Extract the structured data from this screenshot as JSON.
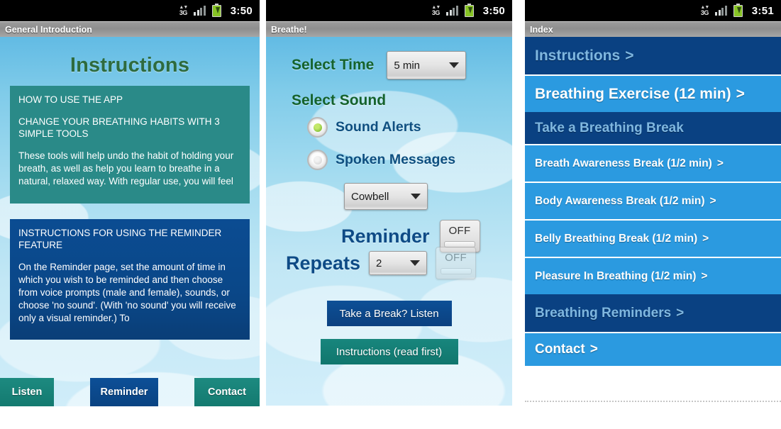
{
  "panel1": {
    "status": {
      "network": "3G",
      "time": "3:50",
      "signal_icon": "signal-bars-icon",
      "battery_icon": "battery-charging-icon",
      "network_icon": "3g-data-icon"
    },
    "title": "General Introduction",
    "heading": "Instructions",
    "box_teal": {
      "heading": "HOW TO USE THE APP",
      "subheading": " CHANGE YOUR BREATHING HABITS WITH 3 SIMPLE TOOLS",
      "body": " These tools will help undo the habit of holding your breath, as well as help you learn to breathe in a natural, relaxed way. With regular use, you will feel"
    },
    "box_navy": {
      "heading": "INSTRUCTIONS FOR USING THE REMINDER FEATURE",
      "body": " On the Reminder page, set the amount of time in which you wish to be reminded and then choose from voice prompts (male and female), sounds, or choose 'no sound'. (With 'no sound' you will receive only a visual reminder.) To"
    },
    "buttons": [
      {
        "label": "Listen",
        "style": "teal"
      },
      {
        "label": "Reminder",
        "style": "navy"
      },
      {
        "label": "Contact",
        "style": "teal"
      }
    ]
  },
  "panel2": {
    "status": {
      "network": "3G",
      "time": "3:50"
    },
    "title": "Breathe!",
    "select_time_label": "Select Time",
    "select_time_value": "5 min",
    "select_sound_label": "Select Sound",
    "radios": [
      {
        "label": "Sound Alerts",
        "selected": true
      },
      {
        "label": "Spoken Messages",
        "selected": false
      }
    ],
    "sound_value": "Cowbell",
    "reminder_label": "Reminder",
    "reminder_toggle": "OFF",
    "repeats_label": "Repeats",
    "repeats_value": "2",
    "repeats_toggle": "OFF",
    "buttons": [
      {
        "label": "Take a Break? Listen",
        "style": "navy"
      },
      {
        "label": "Instructions (read first)",
        "style": "teal"
      }
    ]
  },
  "panel3": {
    "status": {
      "network": "3G",
      "time": "3:51"
    },
    "title": "Index",
    "chevron": ">",
    "items": [
      {
        "label": "Instructions",
        "chevron": ">",
        "style": "dark",
        "size": "big"
      },
      {
        "label": "Breathing Exercise  (12 min)",
        "chevron": ">",
        "style": "bright",
        "size": "big"
      },
      {
        "label": "Take a Breathing Break",
        "chevron": "",
        "style": "dark",
        "size": "mid"
      },
      {
        "label": "Breath Awareness Break (1/2 min)",
        "chevron": ">",
        "style": "bright",
        "size": "small"
      },
      {
        "label": "Body Awareness Break (1/2 min) ",
        "chevron": ">",
        "style": "bright",
        "size": "small"
      },
      {
        "label": "Belly Breathing Break (1/2 min)",
        "chevron": ">",
        "style": "bright",
        "size": "small"
      },
      {
        "label": "Pleasure In Breathing (1/2 min) ",
        "chevron": ">",
        "style": "bright",
        "size": "small"
      },
      {
        "label": "Breathing Reminders",
        "chevron": ">",
        "style": "dark",
        "size": "mid"
      },
      {
        "label": "Contact",
        "chevron": ">",
        "style": "bright",
        "size": "mid"
      }
    ]
  },
  "colors": {
    "sky": "#7fcbe9",
    "teal": "#2a8a88",
    "navy": "#0a4182",
    "bright_blue": "#2b9ae0",
    "green_heading": "#2e6b3e",
    "radio_on": "#8ec63f"
  }
}
